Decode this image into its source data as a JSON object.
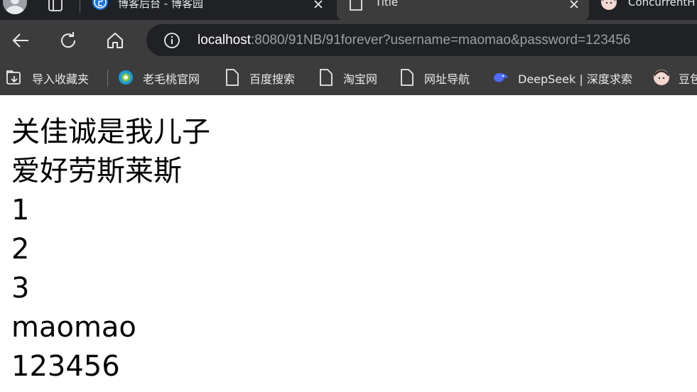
{
  "tabs": [
    {
      "title": "博客后台 - 博客园",
      "icon": "blog-logo-icon",
      "active": false
    },
    {
      "title": "Title",
      "icon": "page-icon",
      "active": true
    },
    {
      "title": "ConcurrentH",
      "icon": "avatar-icon",
      "active": false
    }
  ],
  "address_bar": {
    "host": "localhost",
    "rest": ":8080/91NB/91forever?username=maomao&password=123456"
  },
  "bookmarks": {
    "import": "导入收藏夹",
    "items": [
      {
        "label": "老毛桃官网",
        "icon": "laomaotao-logo-icon"
      },
      {
        "label": "百度搜索",
        "icon": "page-icon"
      },
      {
        "label": "淘宝网",
        "icon": "page-icon"
      },
      {
        "label": "网址导航",
        "icon": "page-icon"
      },
      {
        "label": "DeepSeek | 深度求索",
        "icon": "deepseek-whale-icon"
      },
      {
        "label": "豆包",
        "icon": "doubao-avatar-icon"
      }
    ]
  },
  "colors": {
    "tab_strip": "#202124",
    "toolbar": "#3c3c3c",
    "deepseek_blue": "#4d6bfe"
  },
  "page": {
    "lines": [
      "关佳诚是我儿子",
      "爱好劳斯莱斯",
      "1",
      "2",
      "3",
      "maomao",
      "123456"
    ]
  }
}
